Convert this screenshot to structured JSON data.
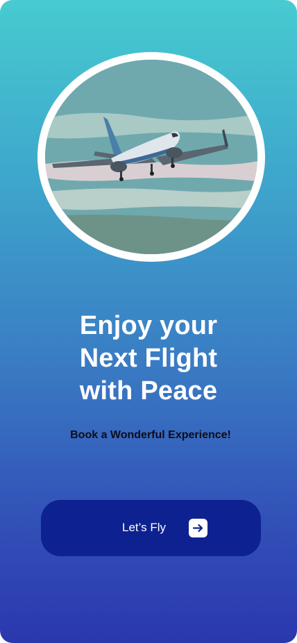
{
  "hero": {
    "image_description": "airplane-in-flight-photo"
  },
  "headline": {
    "line1": "Enjoy your",
    "line2": "Next Flight",
    "line3": "with Peace"
  },
  "subtitle": "Book a Wonderful Experience!",
  "cta": {
    "label": "Let’s Fly",
    "icon": "arrow-right-icon"
  },
  "colors": {
    "gradient_top": "#47cbd0",
    "gradient_bottom": "#2b37ae",
    "button_bg": "#0d2290",
    "headline_text": "#ffffff",
    "subtitle_text": "#0d0d1a"
  }
}
